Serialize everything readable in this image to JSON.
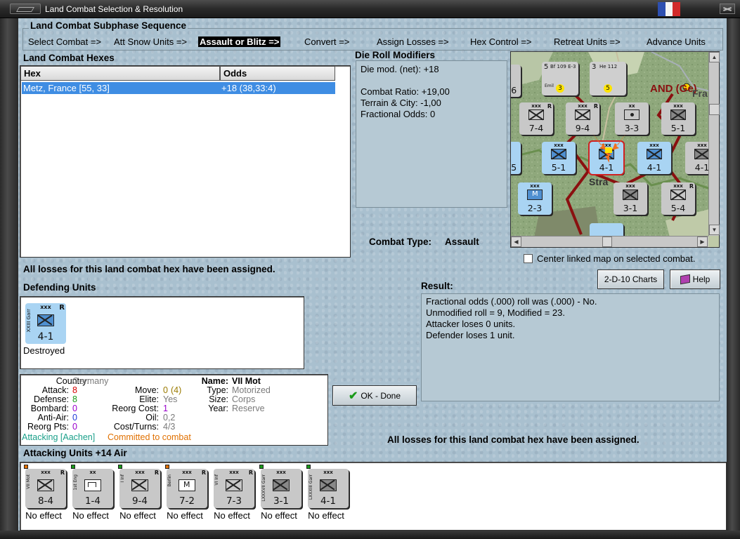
{
  "window": {
    "title": "Land Combat Selection & Resolution"
  },
  "subphase": {
    "heading": "Land Combat Subphase Sequence",
    "items": [
      "Select Combat =>",
      "Att Snow Units =>",
      "Assault or Blitz =>",
      "Convert =>",
      "Assign Losses =>",
      "Hex Control =>",
      "Retreat Units =>",
      "Advance Units"
    ],
    "active_index": 2
  },
  "hexes": {
    "heading": "Land Combat Hexes",
    "columns": [
      "Hex",
      "Odds"
    ],
    "rows": [
      {
        "hex": "Metz, France [55, 33]",
        "odds": "+18 (38,33:4)"
      }
    ]
  },
  "die_roll": {
    "heading": "Die Roll Modifiers",
    "lines": [
      "Die mod. (net): +18",
      "",
      "Combat Ratio: +19,00",
      "Terrain & City: -1,00",
      "Fractional Odds: 0"
    ]
  },
  "combat_type": {
    "label": "Combat Type:",
    "value": "Assault"
  },
  "map": {
    "labels": [
      "AND (Ge)",
      "Fra",
      "Stra"
    ],
    "counters": [
      {
        "strength": "7-4",
        "size": "xxx",
        "type": "inf",
        "color": "gray",
        "r": true
      },
      {
        "strength": "9-4",
        "size": "xxx",
        "type": "inf",
        "color": "gray",
        "r": true
      },
      {
        "strength": "3-3",
        "size": "xx",
        "type": "art",
        "color": "gray"
      },
      {
        "strength": "5-1",
        "size": "xxx",
        "type": "garr",
        "color": "gray"
      },
      {
        "strength": "5-1",
        "size": "xxx",
        "type": "garr",
        "color": "blue"
      },
      {
        "strength": "4-1",
        "size": "xxx",
        "type": "garr",
        "color": "blue"
      },
      {
        "strength": "4-1",
        "size": "xxx",
        "type": "garr",
        "color": "blue"
      },
      {
        "strength": "2-3",
        "size": "xxx",
        "type": "mot",
        "color": "blue"
      },
      {
        "strength": "3-1",
        "size": "xxx",
        "type": "garr",
        "color": "gray"
      },
      {
        "strength": "5-4",
        "size": "xxx",
        "type": "inf",
        "color": "gray",
        "r": true
      },
      {
        "strength": "-6",
        "size": "",
        "type": "inf",
        "color": "gray"
      },
      {
        "strength": "-5",
        "size": "",
        "type": "inf",
        "color": "blue"
      },
      {
        "strength": "4-1",
        "size": "xxx",
        "type": "garr",
        "color": "gray"
      }
    ],
    "air": [
      {
        "name": "Bf 109 E-3",
        "pilot": "Emil",
        "value": "3",
        "num": "5"
      },
      {
        "name": "He 112",
        "value": "5",
        "num": "3"
      }
    ]
  },
  "center_linked": {
    "label": "Center linked map on selected combat.",
    "checked": false
  },
  "losses_msg": "All losses for this land combat hex have been assigned.",
  "defending": {
    "heading": "Defending Units",
    "units": [
      {
        "strength": "4-1",
        "size": "xxx",
        "side": "XXIII Garr",
        "status": "Destroyed"
      }
    ]
  },
  "buttons": {
    "charts": "2-D-10 Charts",
    "help": "Help",
    "ok": "OK - Done"
  },
  "result": {
    "heading": "Result:",
    "lines": [
      "Fractional odds (.000) roll was (.000)  - No.",
      "Unmodified roll = 9, Modified = 23.",
      "Attacker loses 0 units.",
      "Defender loses 1 unit."
    ]
  },
  "unit_info": {
    "country_label": "Country:",
    "country": "Germany",
    "attack_label": "Attack:",
    "attack": "8",
    "defense_label": "Defense:",
    "defense": "8",
    "bombard_label": "Bombard:",
    "bombard": "0",
    "antiair_label": "Anti-Air:",
    "antiair": "0",
    "reorg_pts_label": "Reorg Pts:",
    "reorg_pts": "0",
    "move_label": "Move:",
    "move": "0",
    "move_extra": "(4)",
    "elite_label": "Elite:",
    "elite": "Yes",
    "reorg_cost_label": "Reorg Cost:",
    "reorg_cost": "1",
    "oil_label": "Oil:",
    "oil": "0,2",
    "cost_label": "Cost/Turns:",
    "cost": "4/3",
    "name_label": "Name:",
    "name": "VII Mot",
    "type_label": "Type:",
    "type": "Motorized",
    "size_label": "Size:",
    "size": "Corps",
    "year_label": "Year:",
    "year": "Reserve",
    "attacking": "Attacking [Aachen]",
    "committed": "Committed to combat"
  },
  "attacking": {
    "heading": "Attacking Units +14 Air",
    "units": [
      {
        "strength": "8-4",
        "size": "xxx",
        "side": "VII Mot",
        "sym": "mot",
        "r": true,
        "effect": "No effect"
      },
      {
        "strength": "1-4",
        "size": "xx",
        "side": "1st Eng",
        "sym": "eng",
        "r": false,
        "effect": "No effect"
      },
      {
        "strength": "9-4",
        "size": "xxx",
        "side": "I Inf",
        "sym": "inf",
        "r": true,
        "effect": "No effect"
      },
      {
        "strength": "7-2",
        "size": "xxx",
        "side": "Berlin",
        "sym": "mtn",
        "r": true,
        "effect": "No effect"
      },
      {
        "strength": "7-3",
        "size": "xxx",
        "side": "VI Inf",
        "sym": "inf",
        "r": true,
        "effect": "No effect"
      },
      {
        "strength": "3-1",
        "size": "xxx",
        "side": "LXXXVII Garr",
        "sym": "garr",
        "r": false,
        "effect": "No effect"
      },
      {
        "strength": "4-1",
        "size": "xxx",
        "side": "LXXXIII Garr",
        "sym": "garr",
        "r": false,
        "effect": "No effect"
      }
    ]
  },
  "colors": {
    "selection": "#3f8de3",
    "german_counter": "#c8c8c8",
    "french_counter": "#a9d4f3",
    "border_red": "#8a1010"
  }
}
